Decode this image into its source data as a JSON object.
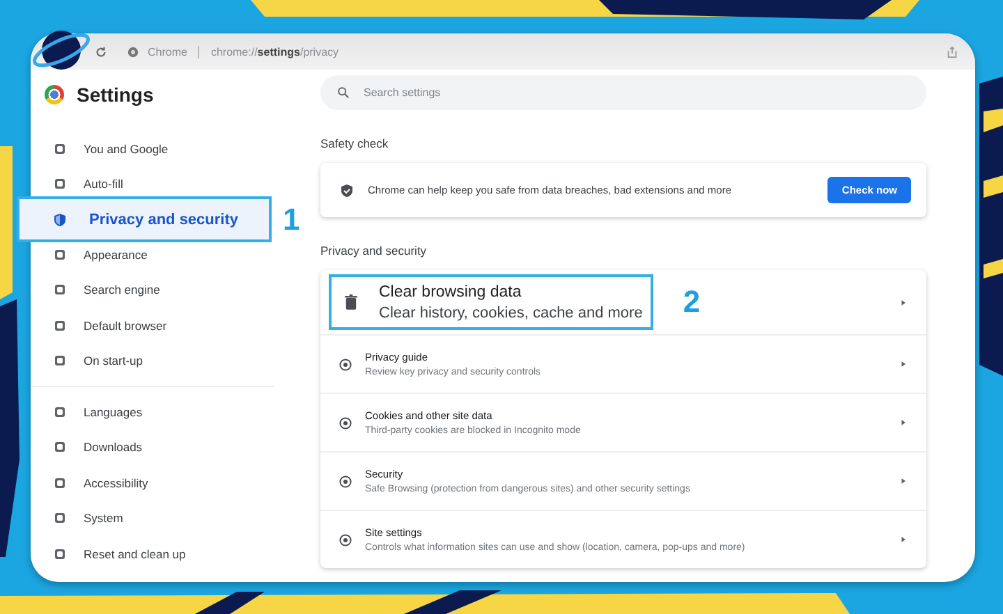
{
  "address_bar": {
    "site_label": "Chrome",
    "url": "chrome://**settings**/privacy"
  },
  "header": {
    "title": "Settings",
    "search": {
      "placeholder": "Search settings"
    }
  },
  "sidebar": {
    "groups": [
      {
        "items": [
          {
            "label": "You and Google",
            "selected": false
          },
          {
            "label": "Auto-fill",
            "selected": false
          },
          {
            "label": "Privacy and security",
            "selected": true,
            "callout": "1"
          },
          {
            "label": "Appearance",
            "selected": false
          },
          {
            "label": "Search engine",
            "selected": false
          },
          {
            "label": "Default browser",
            "selected": false
          },
          {
            "label": "On start-up",
            "selected": false
          }
        ]
      },
      {
        "items": [
          {
            "label": "Languages",
            "selected": false
          },
          {
            "label": "Downloads",
            "selected": false
          },
          {
            "label": "Accessibility",
            "selected": false
          },
          {
            "label": "System",
            "selected": false
          },
          {
            "label": "Reset and clean up",
            "selected": false
          }
        ]
      }
    ]
  },
  "safety_check": {
    "heading": "Safety check",
    "text": "Chrome can help keep you safe from data breaches, bad extensions and more",
    "button": "Check now"
  },
  "privacy_and_security": {
    "heading": "Privacy and security",
    "rows": [
      {
        "title": "Clear browsing data",
        "subtitle": "Clear history, cookies, cache and more",
        "callout": "2"
      },
      {
        "title": "Privacy guide",
        "subtitle": "Review key privacy and security controls"
      },
      {
        "title": "Cookies and other site data",
        "subtitle": "Third-party cookies are blocked in Incognito mode"
      },
      {
        "title": "Security",
        "subtitle": "Safe Browsing (protection from dangerous sites) and other security settings"
      },
      {
        "title": "Site settings",
        "subtitle": "Controls what information sites can use and show (location, camera, pop-ups and more)"
      }
    ]
  }
}
